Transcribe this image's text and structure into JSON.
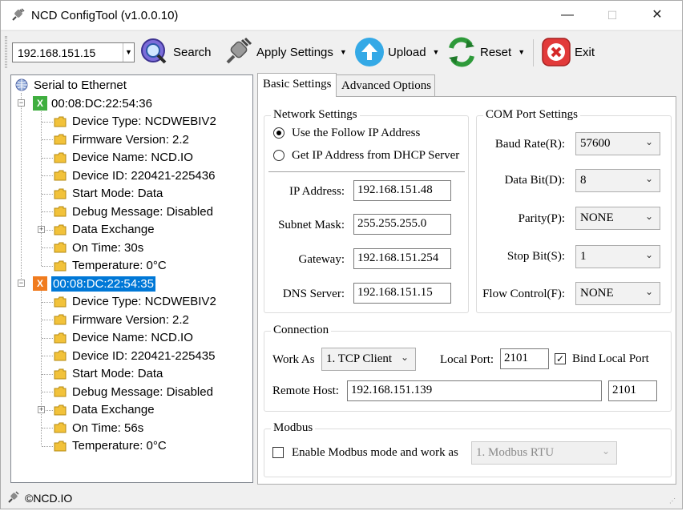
{
  "window": {
    "title": "NCD ConfigTool (v1.0.0.10)",
    "minimize": "—",
    "maximize": "☐",
    "close": "✕"
  },
  "toolbar": {
    "address": "192.168.151.15",
    "search_label": "Search",
    "apply_label": "Apply Settings",
    "upload_label": "Upload",
    "reset_label": "Reset",
    "exit_label": "Exit"
  },
  "tree": {
    "root": "Serial to Ethernet",
    "devices": [
      {
        "mac": "00:08:DC:22:54:36",
        "badge": "X",
        "badge_color": "#3fae3f",
        "items": [
          "Device Type: NCDWEBIV2",
          "Firmware Version: 2.2",
          "Device Name: NCD.IO",
          "Device ID: 220421-225436",
          "Start Mode: Data",
          "Debug Message: Disabled",
          "Data Exchange",
          "On Time: 30s",
          "Temperature: 0°C"
        ]
      },
      {
        "mac": "00:08:DC:22:54:35",
        "badge": "X",
        "badge_color": "#f07b1e",
        "items": [
          "Device Type: NCDWEBIV2",
          "Firmware Version: 2.2",
          "Device Name: NCD.IO",
          "Device ID: 220421-225435",
          "Start Mode: Data",
          "Debug Message: Disabled",
          "Data Exchange",
          "On Time: 56s",
          "Temperature: 0°C"
        ]
      }
    ]
  },
  "tabs": [
    "Basic Settings",
    "Advanced Options"
  ],
  "network": {
    "title": "Network Settings",
    "radio_static": "Use the Follow IP Address",
    "radio_dhcp": "Get IP Address from DHCP Server",
    "ip_label": "IP Address:",
    "ip": "192.168.151.48",
    "mask_label": "Subnet Mask:",
    "mask": "255.255.255.0",
    "gw_label": "Gateway:",
    "gw": "192.168.151.254",
    "dns_label": "DNS Server:",
    "dns": "192.168.151.15"
  },
  "com": {
    "title": "COM Port Settings",
    "baud_label": "Baud Rate(R):",
    "baud": "57600",
    "databit_label": "Data Bit(D):",
    "databit": "8",
    "parity_label": "Parity(P):",
    "parity": "NONE",
    "stopbit_label": "Stop Bit(S):",
    "stopbit": "1",
    "flow_label": "Flow Control(F):",
    "flow": "NONE"
  },
  "connection": {
    "title": "Connection",
    "workas_label": "Work As",
    "workas": "1. TCP Client",
    "localport_label": "Local Port:",
    "localport": "2101",
    "bind_label": "Bind Local Port",
    "remote_label": "Remote Host:",
    "remote_host": "192.168.151.139",
    "remote_port": "2101"
  },
  "modbus": {
    "title": "Modbus",
    "enable_label": "Enable Modbus mode and work as",
    "mode": "1. Modbus RTU"
  },
  "status": {
    "text": "©NCD.IO"
  },
  "icons": {
    "app": "plug-icon",
    "search": "globe-magnifier-icon",
    "apply": "plug-icon",
    "upload": "up-arrow-icon",
    "reset": "recycle-icon",
    "exit": "close-circle-icon",
    "leaf": "folder-icon"
  }
}
